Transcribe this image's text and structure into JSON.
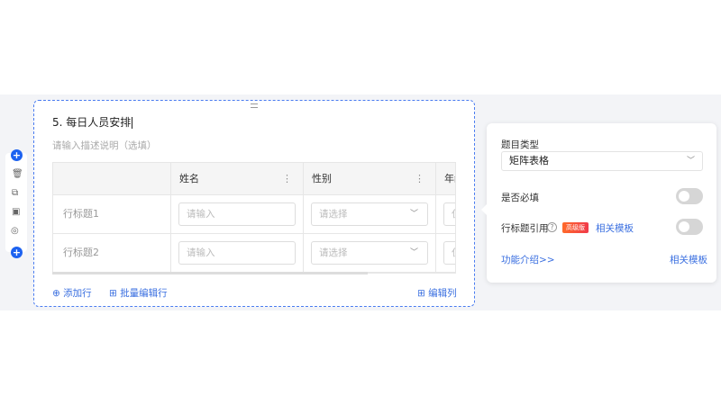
{
  "question": {
    "title": "5. 每日人员安排",
    "description_placeholder": "请输入描述说明（选填）"
  },
  "table": {
    "columns": [
      "姓名",
      "性别",
      "年龄"
    ],
    "rows": [
      {
        "label": "行标题1"
      },
      {
        "label": "行标题2"
      }
    ],
    "input_placeholder": "请输入",
    "select_placeholder": "请选择",
    "partial_placeholder": "仅"
  },
  "footer": {
    "add_row": "添加行",
    "batch_edit_rows": "批量编辑行",
    "edit_columns": "编辑列"
  },
  "toolbar": {
    "icons": [
      "plus-icon",
      "trash-icon",
      "copy-icon",
      "file-icon",
      "eye-off-icon",
      "plus-icon"
    ]
  },
  "panel": {
    "type_label": "题目类型",
    "type_value": "矩阵表格",
    "required_label": "是否必填",
    "required_on": false,
    "row_ref_label": "行标题引用",
    "badge": "高级版",
    "related_template": "相关模板",
    "row_ref_on": false,
    "intro_link": "功能介绍>>",
    "template_link": "相关模板"
  },
  "colors": {
    "accent": "#1d62f0",
    "link": "#3a6fe0"
  }
}
